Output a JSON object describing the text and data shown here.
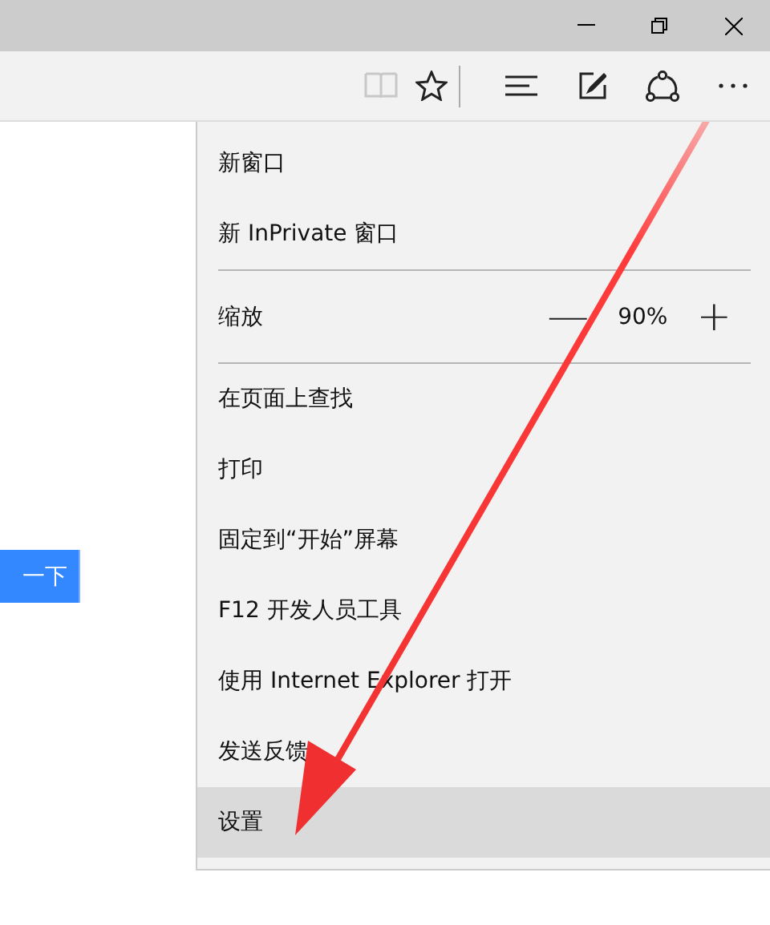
{
  "window": {
    "controls": [
      {
        "kind": "minimize"
      },
      {
        "kind": "restore"
      },
      {
        "kind": "close"
      }
    ]
  },
  "toolbar": {
    "buttons": [
      {
        "kind": "reading",
        "disabled": true
      },
      {
        "kind": "favorite",
        "disabled": false
      },
      {
        "kind": "separator"
      },
      {
        "kind": "hub",
        "disabled": false
      },
      {
        "kind": "note",
        "disabled": false
      },
      {
        "kind": "share",
        "disabled": false
      },
      {
        "kind": "more",
        "disabled": false
      }
    ]
  },
  "page": {
    "button": {
      "label": "一下"
    }
  },
  "menu": {
    "items": [
      {
        "kind": "item",
        "label": "新窗口",
        "selected": false
      },
      {
        "kind": "item",
        "label": "新 InPrivate 窗口",
        "selected": false
      },
      {
        "kind": "separator"
      },
      {
        "kind": "zoom",
        "label": "缩放",
        "minus": "—",
        "value": "90%",
        "plus": "+"
      },
      {
        "kind": "separator"
      },
      {
        "kind": "item",
        "label": "在页面上查找",
        "selected": false
      },
      {
        "kind": "item",
        "label": "打印",
        "selected": false
      },
      {
        "kind": "item",
        "label": "固定到“开始”屏幕",
        "selected": false
      },
      {
        "kind": "item",
        "label": "F12 开发人员工具",
        "selected": false
      },
      {
        "kind": "item",
        "label": "使用 Internet Explorer 打开",
        "selected": false
      },
      {
        "kind": "item",
        "label": "发送反馈",
        "selected": false
      },
      {
        "kind": "item",
        "label": "设置",
        "selected": true
      }
    ]
  },
  "annotation": {
    "kind": "arrow"
  }
}
